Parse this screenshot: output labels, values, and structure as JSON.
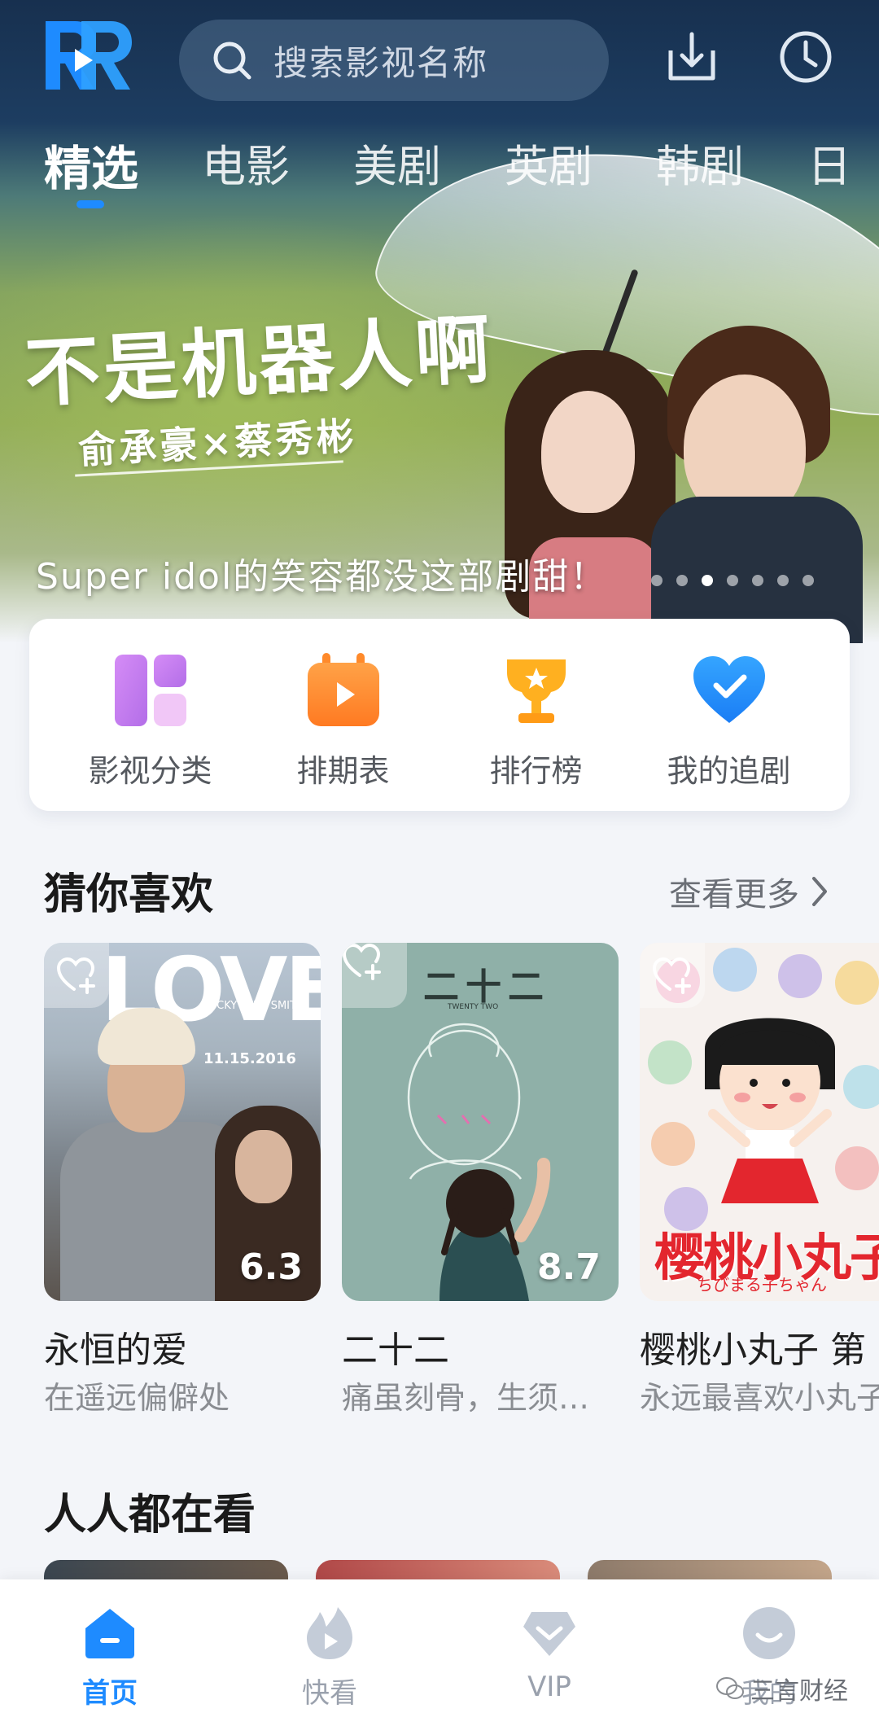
{
  "header": {
    "logo_letters": "RR",
    "search_placeholder": "搜索影视名称"
  },
  "tabs": [
    {
      "label": "精选",
      "active": true
    },
    {
      "label": "电影",
      "active": false
    },
    {
      "label": "美剧",
      "active": false
    },
    {
      "label": "英剧",
      "active": false
    },
    {
      "label": "韩剧",
      "active": false
    },
    {
      "label": "日",
      "active": false
    }
  ],
  "banner": {
    "title": "不是机器人啊",
    "cast": "俞承豪×蔡秀彬",
    "caption": "Super idol的笑容都没这部剧甜！",
    "slide_count": 7,
    "active_slide": 3
  },
  "quick_actions": [
    {
      "label": "影视分类",
      "icon": "category-grid-icon",
      "color": "#c77df0"
    },
    {
      "label": "排期表",
      "icon": "calendar-play-icon",
      "color": "#ff8a2b"
    },
    {
      "label": "排行榜",
      "icon": "trophy-icon",
      "color": "#ffb020"
    },
    {
      "label": "我的追剧",
      "icon": "heart-check-icon",
      "color": "#1e8bff"
    }
  ],
  "recommend": {
    "title": "猜你喜欢",
    "see_more": "查看更多",
    "items": [
      {
        "title": "永恒的爱",
        "subtitle": "在遥远偏僻处",
        "score": "6.3",
        "poster_text": "LOVE",
        "poster_credit": "LUCKY BLUE SMITH",
        "poster_date": "11.15.2016"
      },
      {
        "title": "二十二",
        "subtitle": "痛虽刻骨，生须…",
        "score": "8.7",
        "poster_text": "二十二",
        "poster_credit": "TWENTY TWO"
      },
      {
        "title": "樱桃小丸子 第",
        "subtitle": "永远最喜欢小丸子",
        "score": "",
        "poster_text": "樱桃小丸子",
        "poster_credit": "ちびまる子ちゃん"
      }
    ]
  },
  "popular": {
    "title": "人人都在看"
  },
  "bottom_nav": [
    {
      "label": "首页",
      "icon": "home-icon",
      "active": true
    },
    {
      "label": "快看",
      "icon": "flame-play-icon",
      "active": false
    },
    {
      "label": "VIP",
      "icon": "vip-diamond-icon",
      "active": false
    },
    {
      "label": "我的",
      "icon": "profile-smile-icon",
      "active": false
    }
  ],
  "watermark": "三言财经",
  "colors": {
    "accent": "#1e8bff",
    "header_bg": "#17304f",
    "page_bg": "#f3f5f9"
  }
}
